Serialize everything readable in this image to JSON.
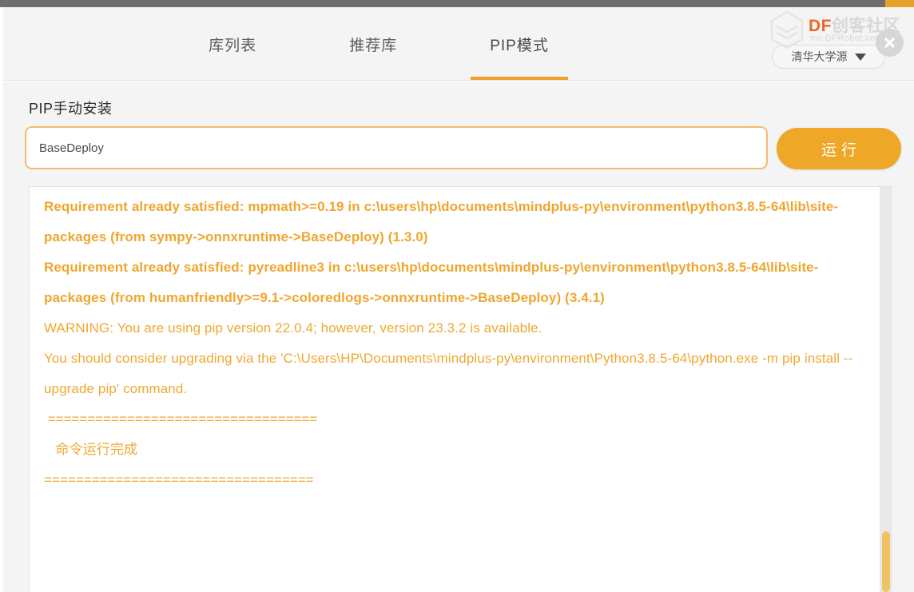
{
  "window": {
    "close_icon": "close-icon"
  },
  "watermark": {
    "brand_prefix": "DF",
    "brand_suffix": "创客社区",
    "url": "mc.DFRobot.com.cn"
  },
  "header": {
    "tabs": [
      {
        "label": "库列表",
        "active": false
      },
      {
        "label": "推荐库",
        "active": false
      },
      {
        "label": "PIP模式",
        "active": true
      }
    ],
    "source_select": {
      "value": "清华大学源",
      "caret_icon": "chevron-down-icon"
    }
  },
  "main": {
    "section_title": "PIP手动安装",
    "package_input": {
      "value": "BaseDeploy",
      "placeholder": ""
    },
    "run_button": "运行"
  },
  "console": {
    "lines": [
      {
        "text": "Requirement already satisfied: mpmath>=0.19 in c:\\users\\hp\\documents\\mindplus-py\\environment\\python3.8.5-64\\lib\\site-packages (from sympy->onnxruntime->BaseDeploy) (1.3.0)",
        "style": "bold"
      },
      {
        "text": "Requirement already satisfied: pyreadline3 in c:\\users\\hp\\documents\\mindplus-py\\environment\\python3.8.5-64\\lib\\site-packages (from humanfriendly>=9.1->coloredlogs->onnxruntime->BaseDeploy) (3.4.1)",
        "style": "bold"
      },
      {
        "text": "WARNING: You are using pip version 22.0.4; however, version 23.3.2 is available.",
        "style": "normal"
      },
      {
        "text": "You should consider upgrading via the 'C:\\Users\\HP\\Documents\\mindplus-py\\environment\\Python3.8.5-64\\python.exe -m pip install --upgrade pip' command.",
        "style": "normal"
      },
      {
        "text": " ==================================",
        "style": "sep"
      },
      {
        "text": "   命令运行完成",
        "style": "normal"
      },
      {
        "text": "==================================",
        "style": "sep"
      }
    ],
    "scroll": {
      "thumb_top_pct": 85,
      "thumb_height_pct": 15
    }
  },
  "colors": {
    "accent": "#efa030",
    "log_text": "#f0a832",
    "brand_orange": "#e8682a",
    "header_bg": "#f4f4f4"
  }
}
